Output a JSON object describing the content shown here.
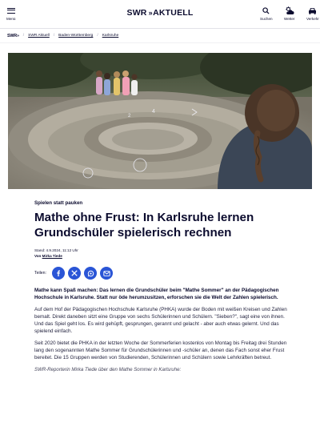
{
  "header": {
    "menu_label": "Menü",
    "logo_text": "SWR",
    "logo_suffix": "AKTUELL",
    "search_label": "Suchen",
    "weather_label": "Wetter",
    "traffic_label": "Verkehr"
  },
  "breadcrumb": {
    "home": "SWR",
    "items": [
      "SWR Aktuell",
      "Baden-Württemberg",
      "Karlsruhe"
    ]
  },
  "article": {
    "kicker": "Spielen statt pauken",
    "title": "Mathe ohne Frust: In Karlsruhe lernen Grundschüler spielerisch rechnen",
    "date": "Stand: 4.9.2024, 11:12 Uhr",
    "author_prefix": "Von",
    "author": "Mirka Tiede",
    "share_label": "Teilen:",
    "lead": "Mathe kann Spaß machen: Das lernen die Grundschüler beim \"Mathe Sommer\" an der Pädagogischen Hochschule in Karlsruhe. Statt nur öde herumzusitzen, erforschen sie die Welt der Zahlen spielerisch.",
    "paragraphs": [
      "Auf dem Hof der Pädagogischen Hochschule Karlsruhe (PHKA) wurde der Boden mit weißen Kreisen und Zahlen bemalt. Direkt daneben sitzt eine Gruppe von sechs Schülerinnen und Schülern. \"Sieben?\", sagt eine von ihnen. Und das Spiel geht los. Es wird gehüpft, gesprungen, gerannt und gelacht - aber auch etwas gelernt. Und das spielend einfach.",
      "Seit 2020 bietet die PHKA in der letzten Woche der Sommerferien kostenlos von Montag bis Freitag drei Stunden lang den sogenannten Mathe Sommer für Grundschülerinnen und -schüler an, denen das Fach sonst eher Frust bereitet. Die 15 Gruppen werden von Studierenden, Schülerinnen und Schülern sowie Lehrkräften betreut."
    ],
    "caption": "SWR-Reporterin Mirka Tiede über den Mathe Sommer in Karlsruhe:"
  },
  "icons": {
    "share": [
      "facebook-icon",
      "x-icon",
      "whatsapp-icon",
      "email-icon"
    ]
  },
  "colors": {
    "brand_dark": "#0b0b2e",
    "share_blue": "#2a55d6"
  }
}
